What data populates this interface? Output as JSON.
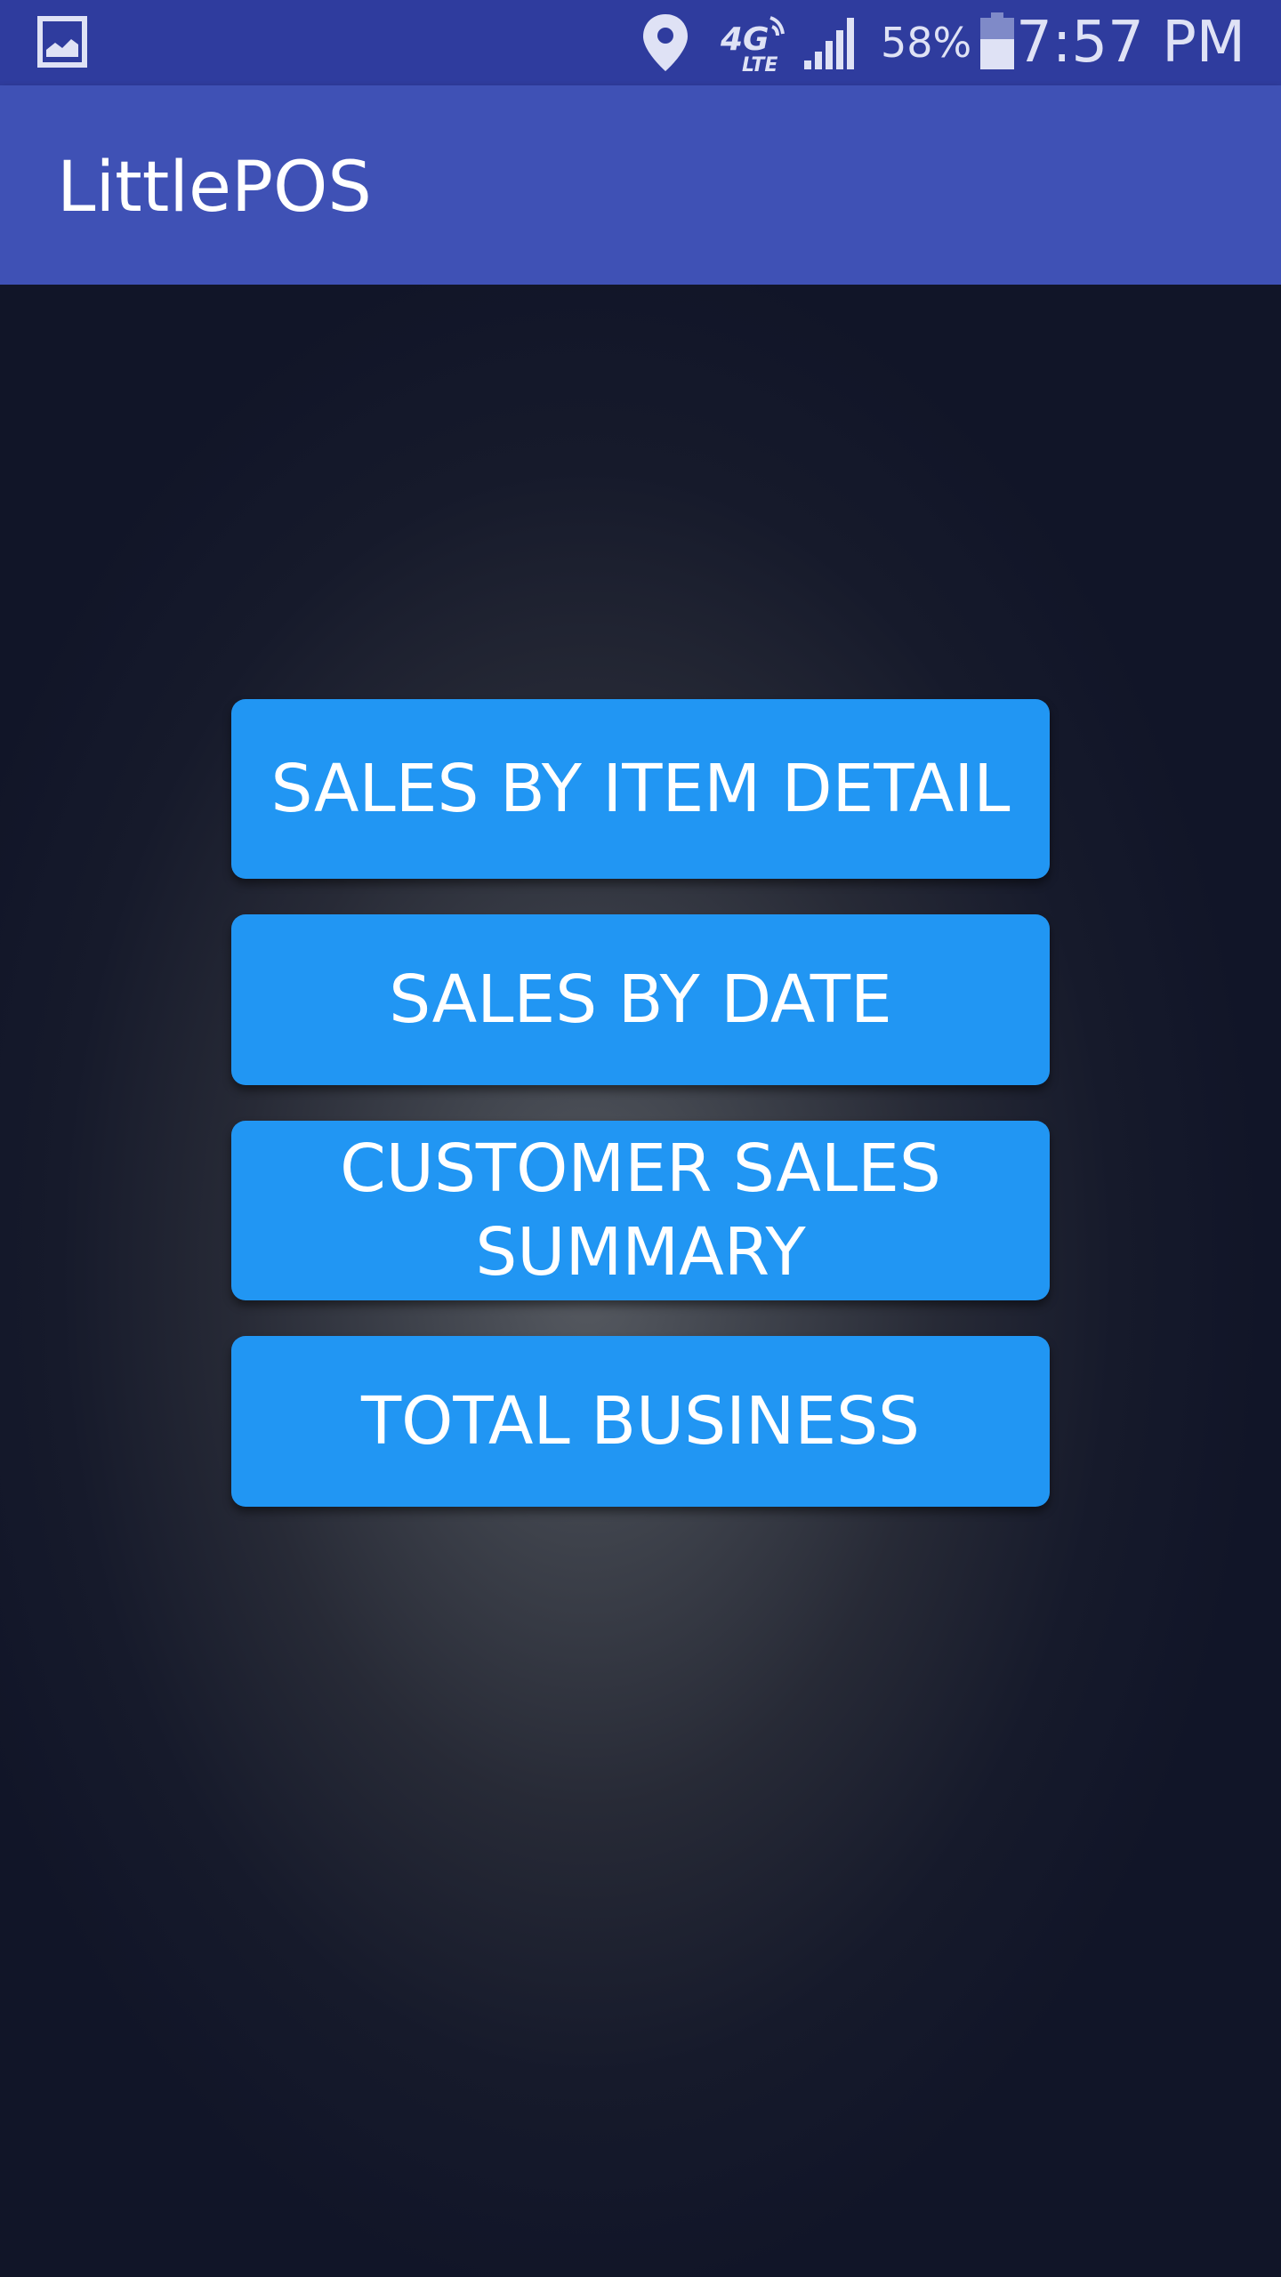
{
  "status_bar": {
    "battery_percent": "58%",
    "time": "7:57 PM",
    "icons": [
      "gallery-icon",
      "location-icon",
      "4g-lte-icon",
      "signal-icon",
      "battery-icon"
    ],
    "network_label": "4G LTE"
  },
  "app_bar": {
    "title": "LittlePOS",
    "color": "#3f51b5"
  },
  "menu": {
    "button_color": "#2196f3",
    "items": [
      {
        "label": "SALES BY ITEM DETAIL"
      },
      {
        "label": "SALES BY DATE"
      },
      {
        "label": "CUSTOMER SALES SUMMARY"
      },
      {
        "label": "TOTAL BUSINESS"
      }
    ]
  }
}
